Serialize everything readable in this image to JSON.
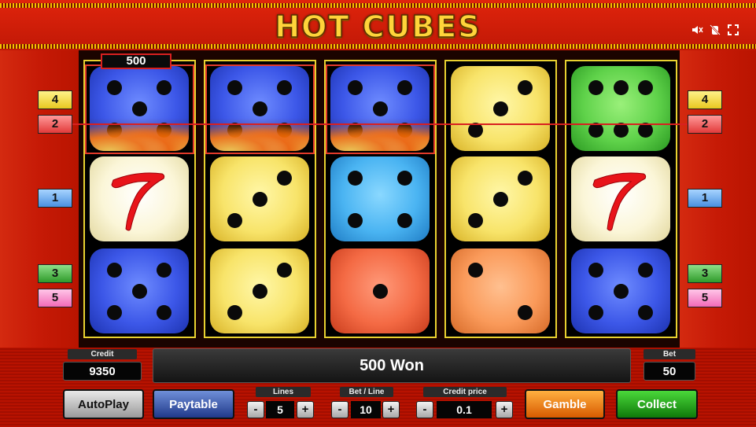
{
  "game": {
    "title": "HOT CUBES"
  },
  "top_icons": [
    "sound-off-icon",
    "no-touch-icon",
    "fullscreen-icon"
  ],
  "win_overlay": {
    "amount": "500"
  },
  "lines_left": [
    "4",
    "2",
    "1",
    "3",
    "5"
  ],
  "lines_right": [
    "4",
    "2",
    "1",
    "3",
    "5"
  ],
  "reels": [
    [
      "blue-5",
      "red-seven",
      "blue-5"
    ],
    [
      "blue-5",
      "yellow-3",
      "yellow-3"
    ],
    [
      "blue-5",
      "cyan-4",
      "red-1"
    ],
    [
      "yellow-3",
      "yellow-3",
      "orange-2"
    ],
    [
      "green-6",
      "red-seven",
      "blue-5"
    ]
  ],
  "winning_cells": [
    "reel1-row1",
    "reel2-row1",
    "reel3-row1"
  ],
  "credit": {
    "label": "Credit",
    "value": "9350"
  },
  "bet": {
    "label": "Bet",
    "value": "50"
  },
  "message": "500 Won",
  "controls": {
    "autoplay": "AutoPlay",
    "paytable": "Paytable",
    "lines": {
      "label": "Lines",
      "value": "5",
      "minus": "-",
      "plus": "+"
    },
    "bet_line": {
      "label": "Bet / Line",
      "value": "10",
      "minus": "-",
      "plus": "+"
    },
    "credit_price": {
      "label": "Credit price",
      "value": "0.1",
      "minus": "-",
      "plus": "+"
    },
    "gamble": "Gamble",
    "collect": "Collect"
  }
}
